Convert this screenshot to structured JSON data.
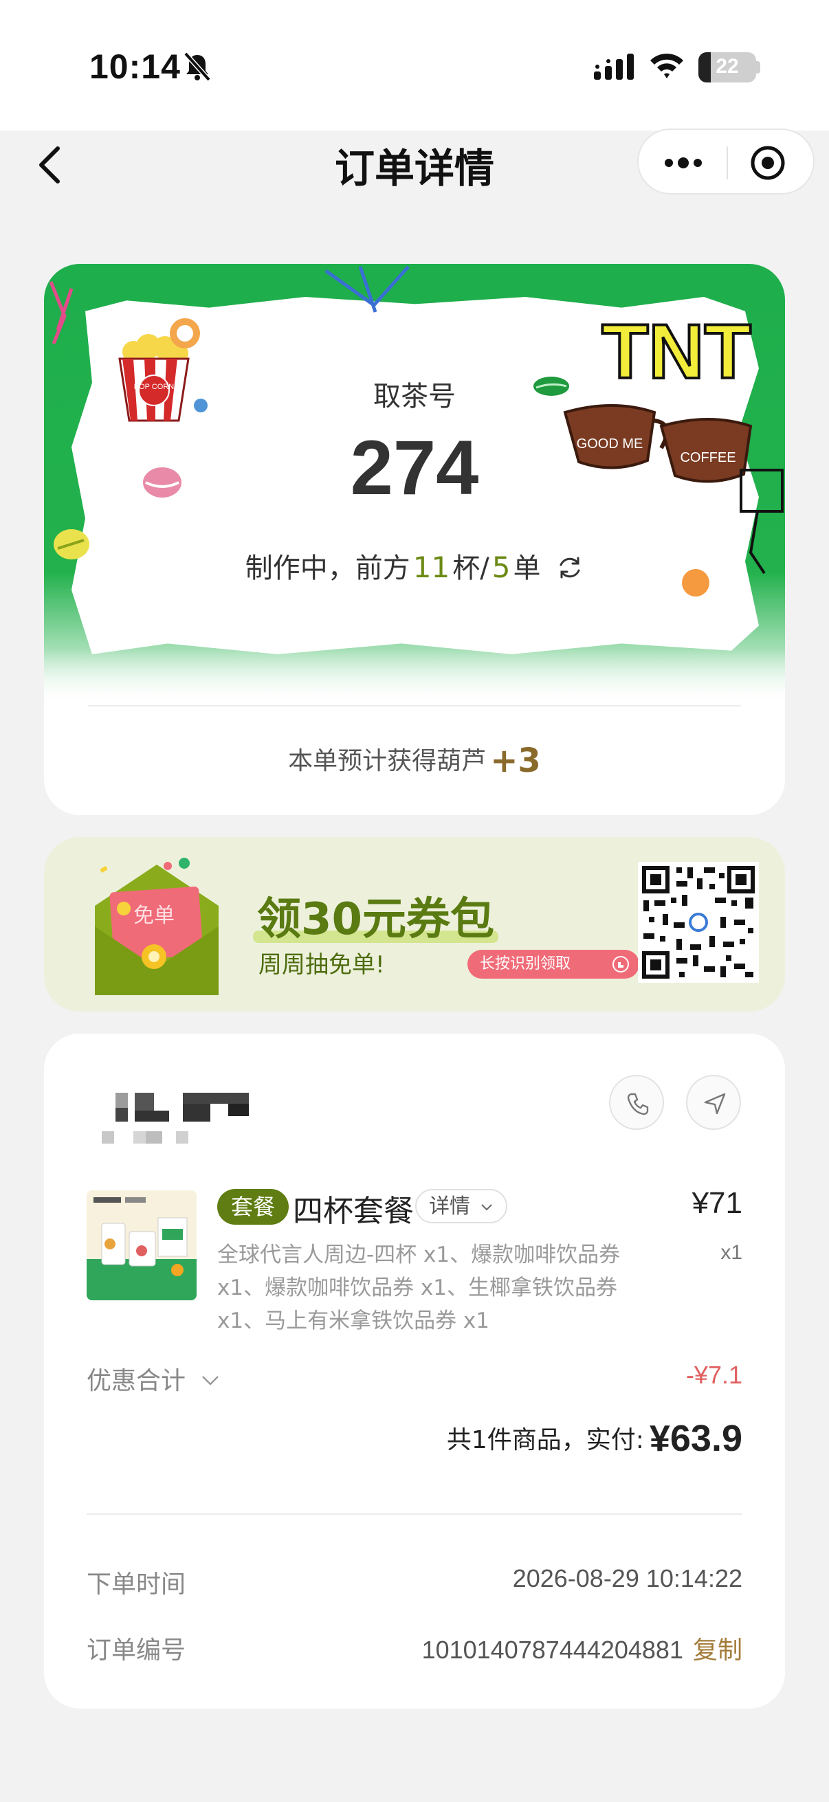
{
  "status_bar": {
    "time": "10:14",
    "battery": "22"
  },
  "nav": {
    "title": "订单详情"
  },
  "pickup": {
    "label": "取茶号",
    "number": "274",
    "status_prefix": "制作中，前方",
    "cups_ahead": "11",
    "cups_unit": "杯/",
    "orders_ahead": "5",
    "orders_unit": "单",
    "poster_tnt": "TNT",
    "poster_goodme": "GOOD ME",
    "poster_coffee": "COFFEE",
    "poster_popcorn": "POP CORN",
    "gourd_text": "本单预计获得葫芦",
    "gourd_points": "+3"
  },
  "coupon": {
    "envelope_label": "免单",
    "title": "领30元券包",
    "subtitle": "周周抽免单!",
    "button": "长按识别领取"
  },
  "order": {
    "product_tag": "套餐",
    "product_name": "四杯套餐",
    "detail_label": "详情",
    "price": "¥71",
    "quantity": "x1",
    "description": "全球代言人周边-四杯 x1、爆款咖啡饮品券 x1、爆款咖啡饮品券 x1、生椰拿铁饮品券 x1、马上有米拿铁饮品券 x1",
    "discount_label": "优惠合计",
    "discount_value": "-¥7.1",
    "total_prefix": "共1件商品，实付:",
    "total_amount": "¥63.9",
    "order_time_label": "下单时间",
    "order_time_value": "2026-08-29 10:14:22",
    "order_no_label": "订单编号",
    "order_no_value": "1010140787444204881",
    "copy_label": "复制"
  },
  "colors": {
    "accent_green": "#5f7d12",
    "poster_green": "#22b14c",
    "discount_red": "#e06060",
    "copy_brown": "#a37c3a",
    "coupon_bg": "#edf1dc"
  }
}
